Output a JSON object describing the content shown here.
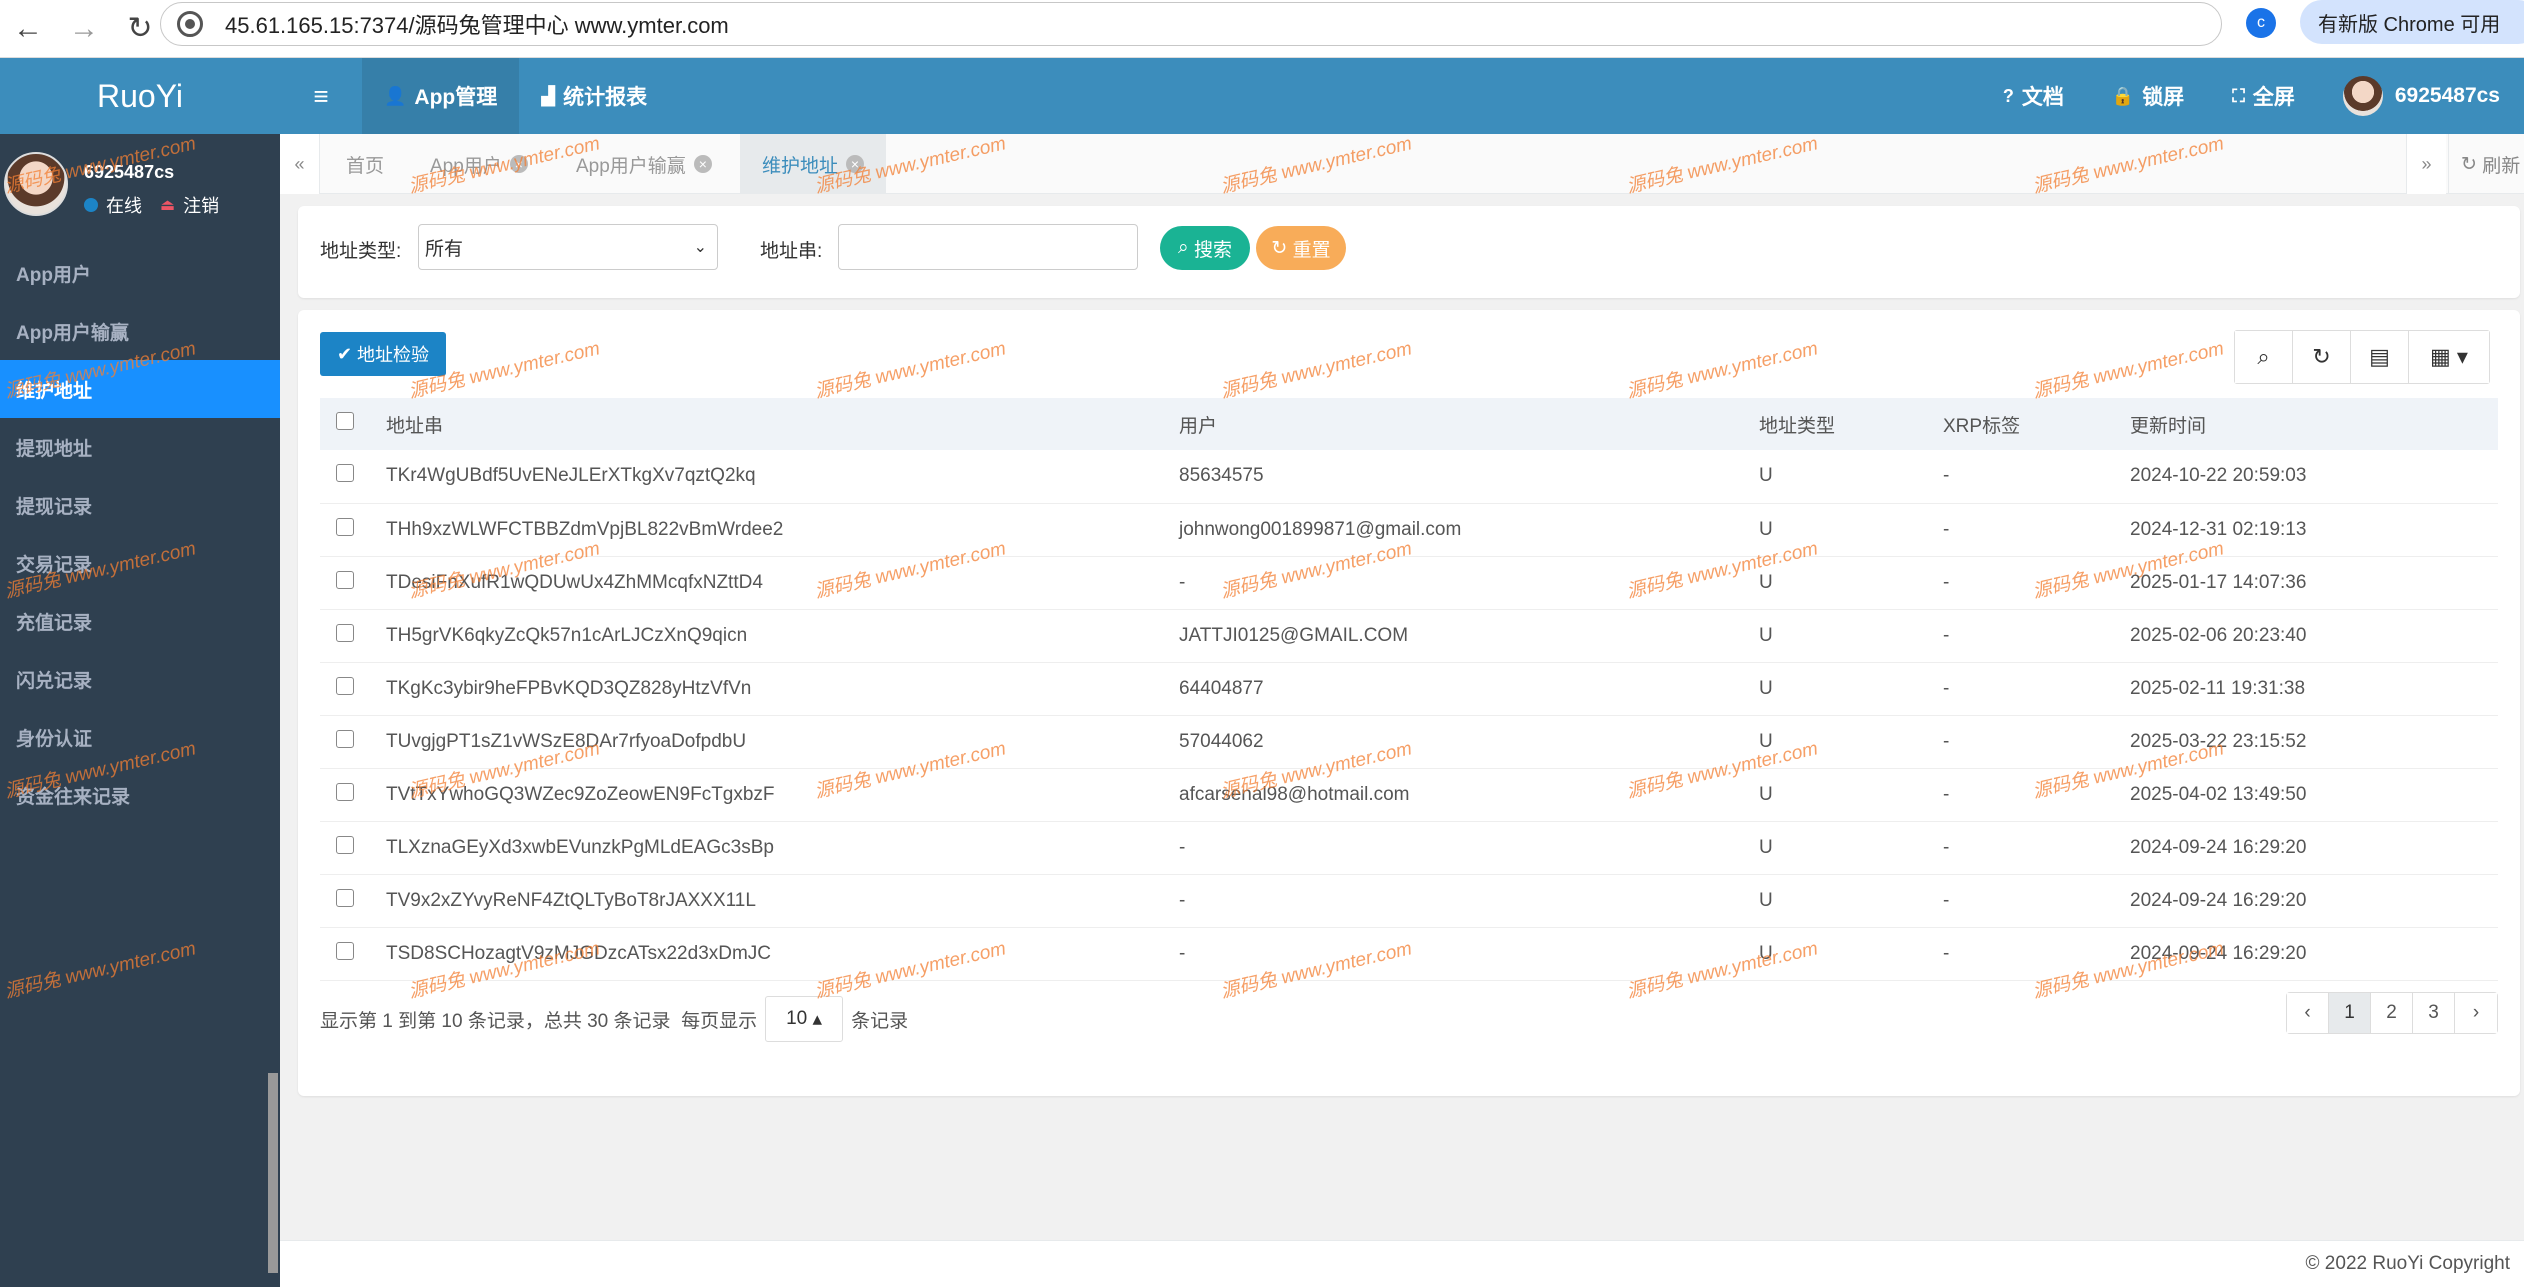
{
  "browser": {
    "url": "45.61.165.15:7374/源码兔管理中心  www.ymter.com",
    "profile_initial": "c",
    "update_label": "有新版 Chrome 可用"
  },
  "app": {
    "logo": "RuoYi",
    "user": {
      "name": "6925487cs",
      "status": "在线",
      "logout": "注销"
    },
    "menu": [
      "App用户",
      "App用户输赢",
      "维护地址",
      "提现地址",
      "提现记录",
      "交易记录",
      "充值记录",
      "闪兑记录",
      "身份认证",
      "资金往来记录"
    ],
    "active_menu": "维护地址",
    "topnav": {
      "app_manage": "App管理",
      "stats": "统计报表",
      "docs": "文档",
      "lock": "锁屏",
      "fullscreen": "全屏",
      "username": "6925487cs"
    },
    "tabs": {
      "home": "首页",
      "t1": "App用户",
      "t2": "App用户输赢",
      "t3": "维护地址",
      "refresh": "刷新"
    }
  },
  "search": {
    "type_label": "地址类型:",
    "type_value": "所有",
    "addr_label": "地址串:",
    "addr_value": "",
    "search_btn": "搜索",
    "reset_btn": "重置"
  },
  "toolbar": {
    "check_btn": "地址检验"
  },
  "table": {
    "headers": [
      "地址串",
      "用户",
      "地址类型",
      "XRP标签",
      "更新时间"
    ],
    "rows": [
      [
        "TKr4WgUBdf5UvENeJLErXTkgXv7qztQ2kq",
        "85634575",
        "U",
        "-",
        "2024-10-22 20:59:03"
      ],
      [
        "THh9xzWLWFCTBBZdmVpjBL822vBmWrdee2",
        "johnwong001899871@gmail.com",
        "U",
        "-",
        "2024-12-31 02:19:13"
      ],
      [
        "TDesiFnXufR1wQDUwUx4ZhMMcqfxNZttD4",
        "-",
        "U",
        "-",
        "2025-01-17 14:07:36"
      ],
      [
        "TH5grVK6qkyZcQk57n1cArLJCzXnQ9qicn",
        "JATTJI0125@GMAIL.COM",
        "U",
        "-",
        "2025-02-06 20:23:40"
      ],
      [
        "TKgKc3ybir9heFPBvKQD3QZ828yHtzVfVn",
        "64404877",
        "U",
        "-",
        "2025-02-11 19:31:38"
      ],
      [
        "TUvgjgPT1sZ1vWSzE8DAr7rfyoaDofpdbU",
        "57044062",
        "U",
        "-",
        "2025-03-22 23:15:52"
      ],
      [
        "TVtTxYwhoGQ3WZec9ZoZeowEN9FcTgxbzF",
        "afcarsenal98@hotmail.com",
        "U",
        "-",
        "2025-04-02 13:49:50"
      ],
      [
        "TLXznaGEyXd3xwbEVunzkPgMLdEAGc3sBp",
        "-",
        "U",
        "-",
        "2024-09-24 16:29:20"
      ],
      [
        "TV9x2xZYvyReNF4ZtQLTyBoT8rJAXXX11L",
        "-",
        "U",
        "-",
        "2024-09-24 16:29:20"
      ],
      [
        "TSD8SCHozagtV9zMJGDzcATsx22d3xDmJC",
        "-",
        "U",
        "-",
        "2024-09-24 16:29:20"
      ]
    ]
  },
  "pagination": {
    "summary_prefix": "显示第 1 到第 10 条记录，总共 30 条记录",
    "per_page_label": "每页显示",
    "per_page_value": "10",
    "per_page_suffix": "条记录",
    "pages": [
      "‹",
      "1",
      "2",
      "3",
      "›"
    ],
    "current": "1"
  },
  "footer": "© 2022 RuoYi Copyright",
  "watermark": "源码兔  www.ymter.com",
  "colors": {
    "header": "#3c8dbc",
    "sidebar": "#2f4050",
    "active_menu": "#1890ff",
    "search_btn": "#1ab394",
    "reset_btn": "#f8ac59",
    "primary": "#1c84c6"
  }
}
